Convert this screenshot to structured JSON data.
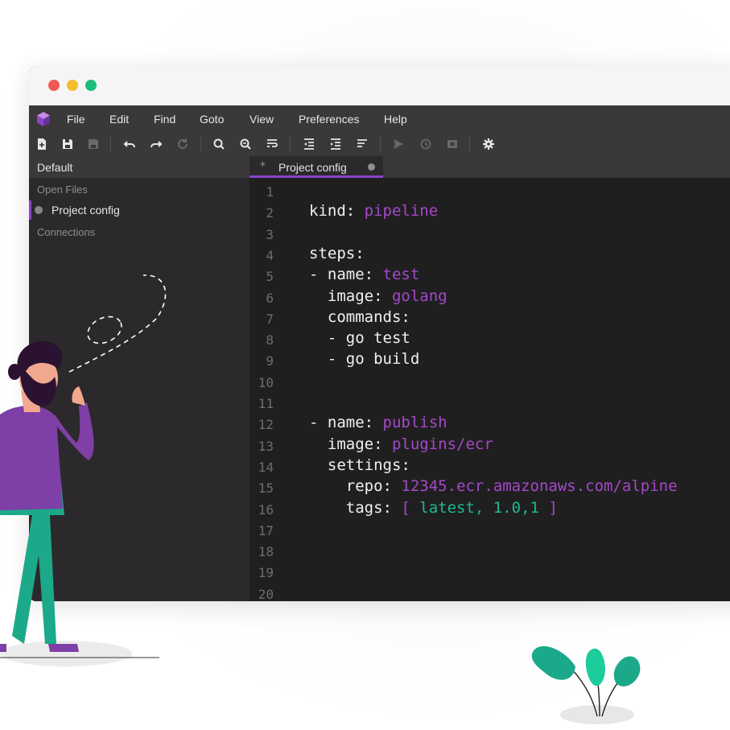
{
  "window": {
    "dots": [
      "#ee5a52",
      "#f5bd2d",
      "#1cbd79"
    ]
  },
  "menu": {
    "items": [
      "File",
      "Edit",
      "Find",
      "Goto",
      "View",
      "Preferences",
      "Help"
    ]
  },
  "toolbar": {
    "icons": [
      "new-file-icon",
      "save-icon",
      "save-all-icon",
      "undo-icon",
      "redo-icon",
      "refresh-icon",
      "search-icon",
      "search-replace-icon",
      "wrap-icon",
      "outdent-icon",
      "indent-icon",
      "format-icon",
      "send-icon",
      "history-icon",
      "screenshot-icon",
      "settings-icon"
    ]
  },
  "sidebar": {
    "header": "Default",
    "open_files_label": "Open Files",
    "files": [
      {
        "name": "Project config"
      }
    ],
    "connections_label": "Connections"
  },
  "editor": {
    "tab": {
      "marker": "*",
      "label": "Project config"
    },
    "lines": [
      {
        "n": "1",
        "k": "",
        "v": ""
      },
      {
        "n": "2",
        "k": "kind: ",
        "v": "pipeline"
      },
      {
        "n": "3",
        "k": "",
        "v": ""
      },
      {
        "n": "4",
        "k": "steps:",
        "v": ""
      },
      {
        "n": "5",
        "k": "- name: ",
        "v": "test"
      },
      {
        "n": "6",
        "k": "  image: ",
        "v": "golang"
      },
      {
        "n": "7",
        "k": "  commands:",
        "v": ""
      },
      {
        "n": "8",
        "k": "  - go test",
        "v": ""
      },
      {
        "n": "9",
        "k": "  - go build",
        "v": ""
      },
      {
        "n": "10",
        "k": "",
        "v": ""
      },
      {
        "n": "11",
        "k": "",
        "v": ""
      },
      {
        "n": "12",
        "k": "- name: ",
        "v": "publish"
      },
      {
        "n": "13",
        "k": "  image: ",
        "v": "plugins/ecr"
      },
      {
        "n": "14",
        "k": "  settings:",
        "v": ""
      },
      {
        "n": "15",
        "k": "    repo: ",
        "v": "12345.ecr.amazonaws.com/alpine"
      },
      {
        "n": "16",
        "k": "    tags: ",
        "v": "[ ",
        "tags": "latest, 1.0,1",
        "end": " ]"
      },
      {
        "n": "17",
        "k": "",
        "v": ""
      },
      {
        "n": "18",
        "k": "",
        "v": ""
      },
      {
        "n": "19",
        "k": "",
        "v": ""
      },
      {
        "n": "20",
        "k": "",
        "v": ""
      }
    ]
  },
  "colors": {
    "accent": "#8b45c9",
    "value": "#a548c9",
    "tag_value": "#1fb893",
    "editor_bg": "#201f20"
  }
}
